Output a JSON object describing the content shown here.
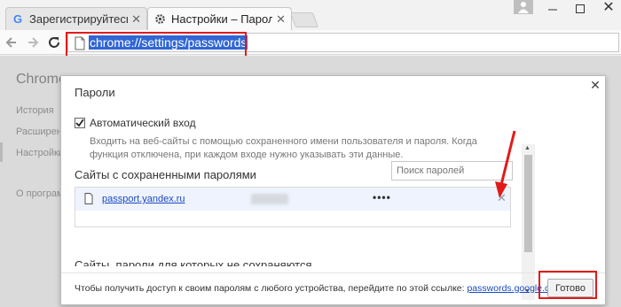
{
  "tabs": [
    {
      "label": "Зарегистрируйтесь",
      "icon": "google-icon",
      "active": false
    },
    {
      "label": "Настройки – Пароли",
      "icon": "settings-gear-icon",
      "active": true
    }
  ],
  "toolbar": {
    "url": "chrome://settings/passwords"
  },
  "background_page": {
    "title": "Chrome",
    "nav_items": [
      "История",
      "Расширения",
      "Настройки",
      "О программе"
    ]
  },
  "dialog": {
    "title": "Пароли",
    "auto_signin": {
      "checked": true,
      "label": "Автоматический вход",
      "description": "Входить на веб-сайты с помощью сохраненного имени пользователя и пароля. Когда функция отключена, при каждом входе нужно указывать эти данные."
    },
    "search": {
      "placeholder": "Поиск паролей"
    },
    "saved_section_title": "Сайты с сохраненными паролями",
    "saved_passwords": [
      {
        "site": "passport.yandex.ru",
        "password_masked": "••••"
      }
    ],
    "never_saved_section_title": "Сайты, пароли для которых не сохраняются",
    "footer": {
      "text": "Чтобы получить доступ к своим паролям с любого устройства, перейдите по этой ссылке:",
      "link": "passwords.google.com",
      "done_label": "Готово"
    }
  },
  "colors": {
    "highlight": "#e21a1a",
    "link": "#1a4ac0",
    "url_selection": "#3166d4"
  }
}
